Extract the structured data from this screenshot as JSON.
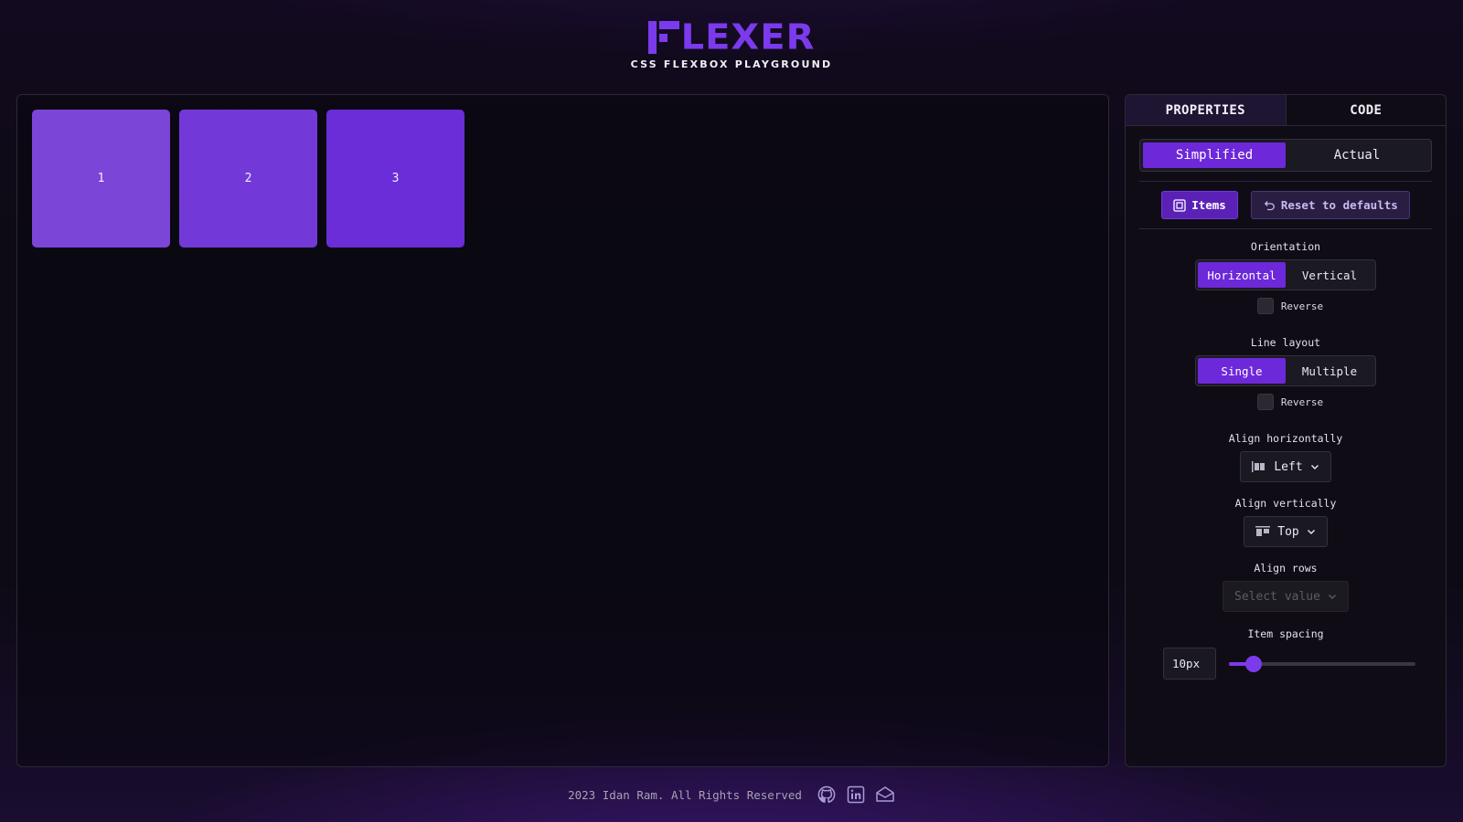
{
  "header": {
    "logo_text": "LEXER",
    "subtitle": "CSS FLEXBOX PLAYGROUND"
  },
  "playground": {
    "items": [
      {
        "label": "1",
        "color": "#7b45d8"
      },
      {
        "label": "2",
        "color": "#7239d8"
      },
      {
        "label": "3",
        "color": "#6a2dd8"
      }
    ]
  },
  "panel": {
    "tabs": [
      "PROPERTIES",
      "CODE"
    ],
    "active_tab": "PROPERTIES",
    "mode": {
      "options": [
        "Simplified",
        "Actual"
      ],
      "selected": "Simplified"
    },
    "scope": {
      "items_label": "Items",
      "reset_label": "Reset to defaults"
    },
    "orientation": {
      "label": "Orientation",
      "options": [
        "Horizontal",
        "Vertical"
      ],
      "selected": "Horizontal",
      "reverse_label": "Reverse",
      "reverse_checked": false
    },
    "line_layout": {
      "label": "Line layout",
      "options": [
        "Single",
        "Multiple"
      ],
      "selected": "Single",
      "reverse_label": "Reverse",
      "reverse_checked": false
    },
    "align_horizontally": {
      "label": "Align horizontally",
      "value": "Left",
      "icon": "align-left-icon"
    },
    "align_vertically": {
      "label": "Align vertically",
      "value": "Top",
      "icon": "align-top-icon"
    },
    "align_rows": {
      "label": "Align rows",
      "placeholder": "Select value",
      "disabled": true
    },
    "item_spacing": {
      "label": "Item spacing",
      "value": "10px",
      "slider_fraction": 0.13
    }
  },
  "footer": {
    "copyright": "2023 Idan Ram. All Rights Reserved",
    "icons": [
      "github-icon",
      "linkedin-icon",
      "mail-icon"
    ]
  },
  "colors": {
    "accent": "#6d28d9",
    "logo": "#7c3aed",
    "background": "#0d0a14"
  }
}
